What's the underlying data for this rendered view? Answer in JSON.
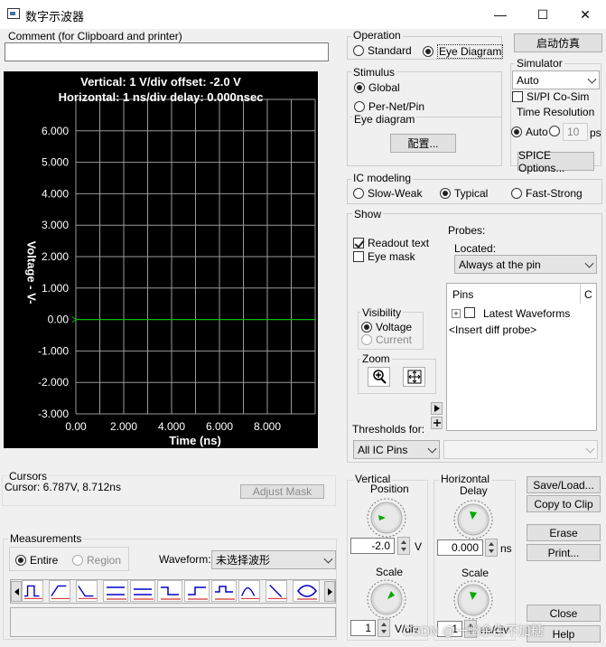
{
  "window": {
    "title": "数字示波器",
    "minimize": "—",
    "maximize": "☐",
    "close": "✕"
  },
  "comment": {
    "label": "Comment (for Clipboard and printer)",
    "value": ""
  },
  "scope": {
    "readout_line1": "Vertical: 1  V/div  offset: -2.0 V",
    "readout_line2": "Horizontal: 1 ns/div  delay: 0.000nsec",
    "ylabel": "Voltage  - V-",
    "xlabel": "Time  (ns)"
  },
  "chart_data": {
    "type": "line",
    "title": "",
    "xlabel": "Time  (ns)",
    "ylabel": "Voltage  - V-",
    "xlim": [
      0,
      10
    ],
    "ylim": [
      -3,
      7
    ],
    "x_ticks": [
      "0.00",
      "2.000",
      "4.000",
      "6.000",
      "8.000"
    ],
    "y_ticks": [
      "6.000",
      "5.000",
      "4.000",
      "3.000",
      "2.000",
      "1.000",
      "0.00",
      "-1.000",
      "-2.000",
      "-3.000"
    ],
    "grid": true,
    "series": [
      {
        "color": "#00c000",
        "x": [
          0,
          10
        ],
        "y": [
          0,
          0
        ]
      }
    ]
  },
  "operation": {
    "label": "Operation",
    "standard": "Standard",
    "eye": "Eye Diagram",
    "selected": "eye"
  },
  "start_button": "启动仿真",
  "simulator": {
    "label": "Simulator",
    "value": "Auto",
    "cosim": "SI/PI Co-Sim"
  },
  "time_resolution": {
    "label": "Time Resolution",
    "auto": "Auto",
    "value": "10",
    "unit": "ps"
  },
  "stimulus": {
    "label": "Stimulus",
    "global": "Global",
    "per_net": "Per-Net/Pin"
  },
  "eye_diagram": {
    "label": "Eye diagram",
    "config_button": "配置..."
  },
  "spice_button": "SPICE Options...",
  "ic_modeling": {
    "label": "IC modeling",
    "slow": "Slow-Weak",
    "typical": "Typical",
    "fast": "Fast-Strong"
  },
  "show": {
    "label": "Show",
    "readout": "Readout text",
    "eye_mask": "Eye mask",
    "probes": "Probes:",
    "located": "Located:",
    "located_value": "Always at the pin"
  },
  "visibility": {
    "label": "Visibility",
    "voltage": "Voltage",
    "current": "Current"
  },
  "zoom": {
    "label": "Zoom"
  },
  "pins": {
    "header_pins": "Pins",
    "header_c": "C",
    "expand": "+",
    "latest": "Latest Waveforms",
    "insert": "<Insert diff probe>"
  },
  "thresholds": {
    "label": "Thresholds for:",
    "value": "All IC Pins",
    "value2": ""
  },
  "cursors": {
    "label": "Cursors",
    "value": "Cursor: 6.787V, 8.712ns",
    "adjust_mask": "Adjust Mask"
  },
  "measurements": {
    "label": "Measurements",
    "entire": "Entire",
    "region": "Region",
    "waveform_label": "Waveform:",
    "waveform_value": "未选择波形"
  },
  "vertical": {
    "label": "Vertical",
    "position": "Position",
    "position_value": "-2.0",
    "position_unit": "V",
    "scale": "Scale",
    "scale_value": "1",
    "scale_unit": "V/div"
  },
  "horizontal": {
    "label": "Horizontal",
    "delay": "Delay",
    "delay_value": "0.000",
    "delay_unit": "ns",
    "scale": "Scale",
    "scale_value": "1",
    "scale_unit": "ns/div"
  },
  "buttons": {
    "save_load": "Save/Load...",
    "copy_clip": "Copy to Clip",
    "erase": "Erase",
    "print": "Print...",
    "close": "Close",
    "help": "Help"
  },
  "watermark": "CSDN @一幽余生不加糖"
}
